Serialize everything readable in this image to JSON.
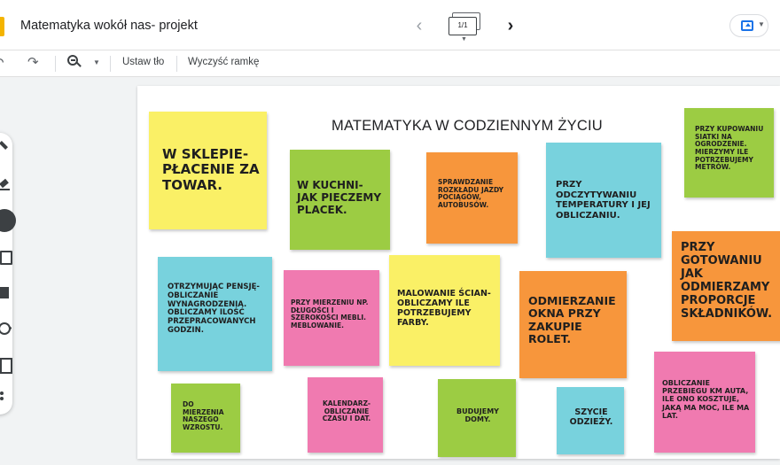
{
  "header": {
    "title": "Matematyka wokół nas- projekt",
    "frame_counter": "1/1"
  },
  "toolbar": {
    "set_background": "Ustaw tło",
    "clear_frame": "Wyczyść ramkę"
  },
  "icons": {
    "prev": "chevron-left-icon",
    "next": "chevron-right-icon",
    "undo": "undo-icon",
    "redo": "redo-icon",
    "zoom": "zoom-icon",
    "share": "present-icon"
  },
  "canvas": {
    "title": "MATEMATYKA W CODZIENNYM ŻYCIU",
    "notes": [
      {
        "color": "yellow",
        "text": "W SKLEPIE- PŁACENIE ZA TOWAR."
      },
      {
        "color": "green",
        "text": "W KUCHNI- JAK PIECZEMY PLACEK."
      },
      {
        "color": "orange",
        "text": "SPRAWDZANIE ROZKŁADU JAZDY POCIĄGÓW, AUTOBUSÓW."
      },
      {
        "color": "blue",
        "text": "PRZY ODCZYTYWANIU TEMPERATURY I JEJ OBLICZANIU."
      },
      {
        "color": "green",
        "text": "PRZY KUPOWANIU SIATKI NA OGRODZENIE. MIERZYMY ILE POTRZEBUJEMY METRÓW."
      },
      {
        "color": "orange",
        "text": "PRZY GOTOWANIU JAK ODMIERZAMY PROPORCJE SKŁADNIKÓW."
      },
      {
        "color": "blue",
        "text": "OTRZYMUJĄC PENSJĘ- OBLICZANIE WYNAGRODZENIA. OBLICZAMY ILOŚĆ PRZEPRACOWANYCH GODZIN."
      },
      {
        "color": "pink",
        "text": "PRZY MIERZENIU NP. DŁUGOŚCI I SZEROKOŚCI MEBLI. MEBLOWANIE."
      },
      {
        "color": "yellow",
        "text": "MALOWANIE ŚCIAN- OBLICZAMY ILE POTRZEBUJEMY FARBY."
      },
      {
        "color": "orange",
        "text": "ODMIERZANIE OKNA PRZY ZAKUPIE ROLET."
      },
      {
        "color": "green",
        "text": "DO MIERZENIA NASZEGO WZROSTU."
      },
      {
        "color": "pink",
        "text": "KALENDARZ- OBLICZANIE CZASU I DAT."
      },
      {
        "color": "green",
        "text": "BUDUJEMY DOMY."
      },
      {
        "color": "blue",
        "text": "SZYCIE ODZIEŻY."
      },
      {
        "color": "pink",
        "text": "OBLICZANIE PRZEBIEGU KM AUTA, ILE ONO KOSZTUJE, JAKĄ MA MOC, ILE MA LAT."
      }
    ]
  }
}
